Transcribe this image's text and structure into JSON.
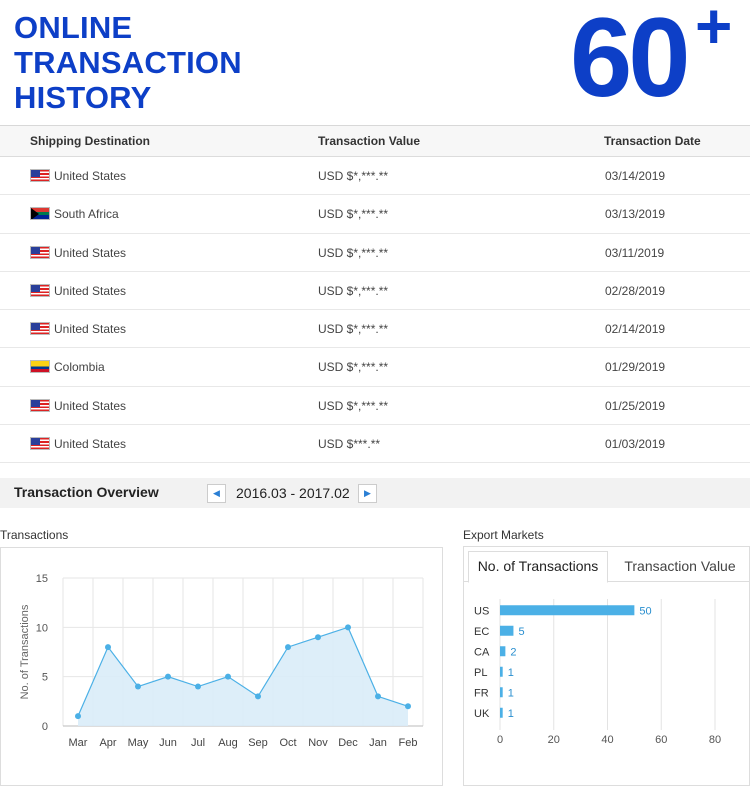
{
  "hero": {
    "title_lines": [
      "ONLINE",
      "TRANSACTION",
      "HISTORY"
    ],
    "count": "60",
    "count_suffix": "+"
  },
  "table": {
    "headers": [
      "Shipping Destination",
      "Transaction Value",
      "Transaction Date"
    ],
    "rows": [
      {
        "flag": "us-flag-icon",
        "country": "United States",
        "value": "USD $*,***.**",
        "date": "03/14/2019"
      },
      {
        "flag": "za-flag-icon",
        "country": "South Africa",
        "value": "USD $*,***.**",
        "date": "03/13/2019"
      },
      {
        "flag": "us-flag-icon",
        "country": "United States",
        "value": "USD $*,***.**",
        "date": "03/11/2019"
      },
      {
        "flag": "us-flag-icon",
        "country": "United States",
        "value": "USD $*,***.**",
        "date": "02/28/2019"
      },
      {
        "flag": "us-flag-icon",
        "country": "United States",
        "value": "USD $*,***.**",
        "date": "02/14/2019"
      },
      {
        "flag": "co-flag-icon",
        "country": "Colombia",
        "value": "USD $*,***.**",
        "date": "01/29/2019"
      },
      {
        "flag": "us-flag-icon",
        "country": "United States",
        "value": "USD $*,***.**",
        "date": "01/25/2019"
      },
      {
        "flag": "us-flag-icon",
        "country": "United States",
        "value": "USD $***.**",
        "date": "01/03/2019"
      }
    ]
  },
  "overview": {
    "title": "Transaction Overview",
    "range": "2016.03 - 2017.02",
    "prev_icon": "caret-left-icon",
    "next_icon": "caret-right-icon"
  },
  "transactions_label": "Transactions",
  "markets": {
    "label": "Export Markets",
    "tabs": [
      "No. of Transactions",
      "Transaction Value"
    ],
    "active_tab": 0
  },
  "colors": {
    "accent": "#0d3fc7",
    "chart": "#4bb0e6",
    "chart_fill": "#d9ecf8"
  },
  "chart_data": [
    {
      "type": "area",
      "title": "",
      "xlabel": "",
      "ylabel": "No. of Transactions",
      "categories": [
        "Mar",
        "Apr",
        "May",
        "Jun",
        "Jul",
        "Aug",
        "Sep",
        "Oct",
        "Nov",
        "Dec",
        "Jan",
        "Feb"
      ],
      "values": [
        1,
        8,
        4,
        5,
        4,
        5,
        3,
        8,
        9,
        10,
        3,
        2
      ],
      "ylim": [
        0,
        15
      ],
      "yticks": [
        0,
        5,
        10,
        15
      ],
      "grid": true
    },
    {
      "type": "bar",
      "orientation": "horizontal",
      "categories": [
        "US",
        "EC",
        "CA",
        "PL",
        "FR",
        "UK"
      ],
      "values": [
        50,
        5,
        2,
        1,
        1,
        1
      ],
      "xlim": [
        0,
        80
      ],
      "xticks": [
        0,
        20,
        40,
        60,
        80
      ],
      "grid": true
    }
  ]
}
